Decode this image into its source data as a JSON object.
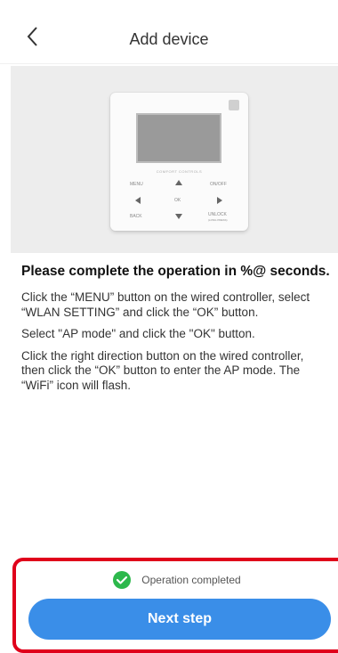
{
  "header": {
    "title": "Add device",
    "back_icon": "chevron-left-icon"
  },
  "device_image": {
    "brand": "COMFORT CONTROLS",
    "menu": "MENU",
    "onoff": "ON/OFF",
    "ok": "OK",
    "back": "BACK",
    "unlock": "UNLOCK",
    "unlock_sub": "(LONG PRESS)"
  },
  "content": {
    "headline": "Please complete the operation in %@ seconds.",
    "steps": [
      "Click the “MENU” button on the wired controller, select “WLAN SETTING” and click the “OK” button.",
      "Select \"AP mode\" and click the \"OK\" button.",
      "Click the right direction button on the wired controller, then click the “OK” button to enter the AP mode. The “WiFi” icon will flash."
    ]
  },
  "footer": {
    "status_text": "Operation completed",
    "status_icon": "check-circle-icon",
    "status_color": "#2db84c",
    "next_label": "Next step",
    "accent_color": "#3a8ee8"
  }
}
